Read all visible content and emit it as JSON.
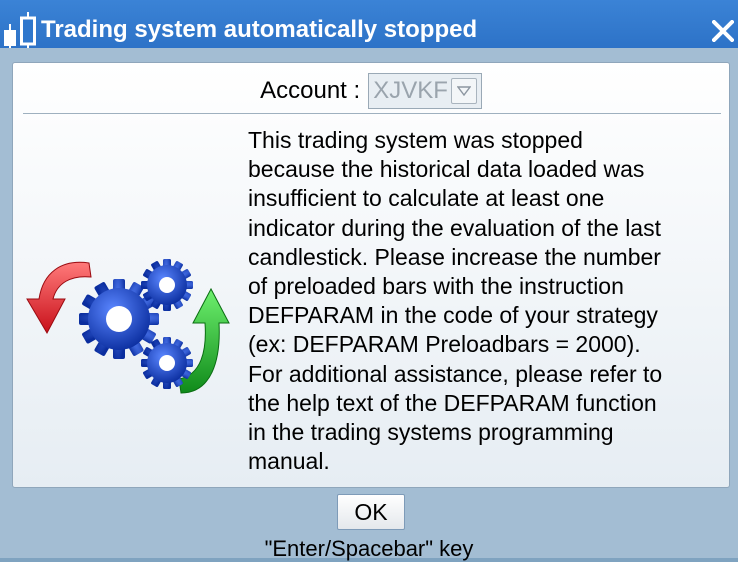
{
  "window": {
    "title": "Trading system automatically stopped",
    "app_icon": "candlestick-icon",
    "close_icon": "close-icon"
  },
  "account": {
    "label": "Account :",
    "selected_value": "XJVKF"
  },
  "illustration": {
    "icon": "gears-cycle-icon",
    "colors": {
      "gear": "#1746c6",
      "left_arrow": "#e03131",
      "right_arrow": "#2fb82f"
    }
  },
  "message": {
    "lines": [
      "This trading system was stopped",
      "because the historical data loaded was",
      "insufficient to calculate at least one",
      "indicator during the evaluation of the last",
      "candlestick. Please increase the number",
      "of preloaded bars with the instruction",
      "DEFPARAM in the code of your strategy",
      "(ex: DEFPARAM Preloadbars = 2000).",
      "For additional assistance, please refer to",
      "the help text of the DEFPARAM function",
      "in the trading systems programming",
      "manual."
    ]
  },
  "ok_button": {
    "label": "OK"
  },
  "hint": "\"Enter/Spacebar\" key",
  "colors": {
    "titlebar": "#2f77cc",
    "window_bg": "#a3bdd3"
  }
}
